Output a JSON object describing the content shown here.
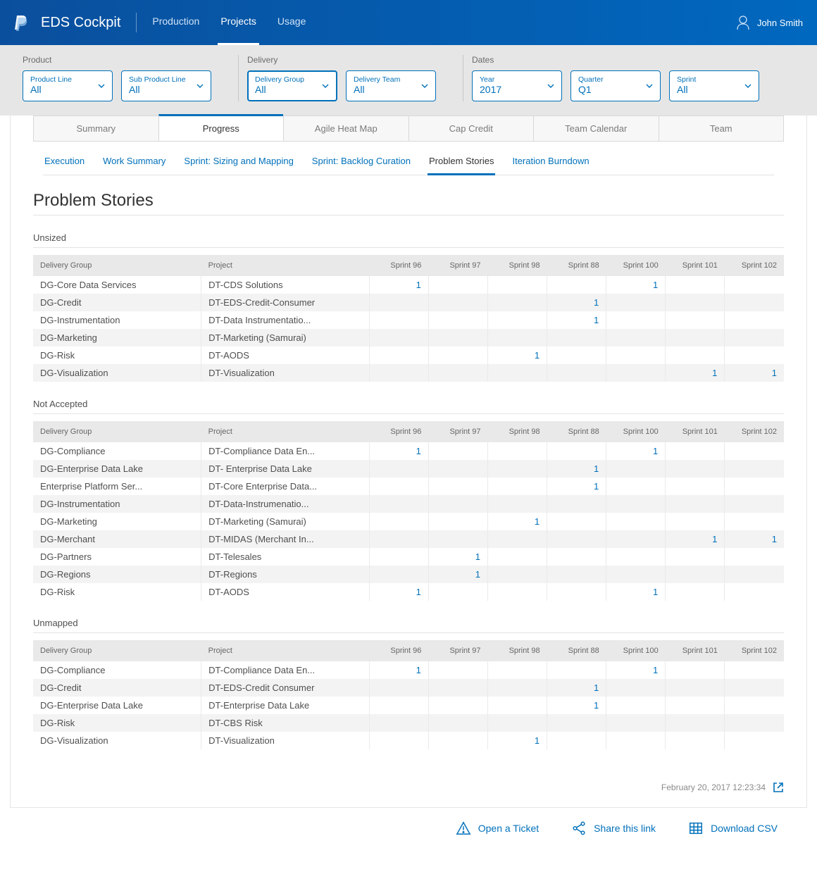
{
  "header": {
    "app_title": "EDS Cockpit",
    "nav": [
      "Production",
      "Projects",
      "Usage"
    ],
    "active_nav": 1,
    "user_name": "John Smith"
  },
  "filters": {
    "product": {
      "label": "Product",
      "items": [
        {
          "label": "Product Line",
          "value": "All"
        },
        {
          "label": "Sub Product Line",
          "value": "All"
        }
      ]
    },
    "delivery": {
      "label": "Delivery",
      "items": [
        {
          "label": "Delivery Group",
          "value": "All",
          "active": true
        },
        {
          "label": "Delivery Team",
          "value": "All"
        }
      ]
    },
    "dates": {
      "label": "Dates",
      "items": [
        {
          "label": "Year",
          "value": "2017"
        },
        {
          "label": "Quarter",
          "value": "Q1"
        },
        {
          "label": "Sprint",
          "value": "All"
        }
      ]
    }
  },
  "tabs_main": [
    "Summary",
    "Progress",
    "Agile Heat Map",
    "Cap Credit",
    "Team Calendar",
    "Team"
  ],
  "tabs_main_active": 1,
  "subtabs": [
    "Execution",
    "Work Summary",
    "Sprint: Sizing and Mapping",
    "Sprint: Backlog Curation",
    "Problem Stories",
    "Iteration Burndown"
  ],
  "subtabs_active": 4,
  "page_title": "Problem Stories",
  "columns": [
    "Delivery Group",
    "Project",
    "Sprint 96",
    "Sprint 97",
    "Sprint 98",
    "Sprint 88",
    "Sprint 100",
    "Sprint 101",
    "Sprint 102"
  ],
  "sections": [
    {
      "title": "Unsized",
      "rows": [
        {
          "dg": "DG-Core Data Services",
          "proj": "DT-CDS Solutions",
          "vals": [
            "1",
            "",
            "",
            "",
            "1",
            "",
            ""
          ]
        },
        {
          "dg": "DG-Credit",
          "proj": "DT-EDS-Credit-Consumer",
          "vals": [
            "",
            "",
            "",
            "1",
            "",
            "",
            ""
          ]
        },
        {
          "dg": "DG-Instrumentation",
          "proj": "DT-Data Instrumentatio...",
          "vals": [
            "",
            "",
            "",
            "1",
            "",
            "",
            ""
          ]
        },
        {
          "dg": "DG-Marketing",
          "proj": "DT-Marketing (Samurai)",
          "vals": [
            "",
            "",
            "",
            "",
            "",
            "",
            ""
          ]
        },
        {
          "dg": "DG-Risk",
          "proj": "DT-AODS",
          "vals": [
            "",
            "",
            "1",
            "",
            "",
            "",
            ""
          ]
        },
        {
          "dg": "DG-Visualization",
          "proj": "DT-Visualization",
          "vals": [
            "",
            "",
            "",
            "",
            "",
            "1",
            "1"
          ]
        }
      ]
    },
    {
      "title": "Not Accepted",
      "rows": [
        {
          "dg": "DG-Compliance",
          "proj": "DT-Compliance Data En...",
          "vals": [
            "1",
            "",
            "",
            "",
            "1",
            "",
            ""
          ]
        },
        {
          "dg": "DG-Enterprise Data Lake",
          "proj": "DT- Enterprise Data Lake",
          "vals": [
            "",
            "",
            "",
            "1",
            "",
            "",
            ""
          ]
        },
        {
          "dg": "Enterprise Platform Ser...",
          "proj": "DT-Core Enterprise Data...",
          "vals": [
            "",
            "",
            "",
            "1",
            "",
            "",
            ""
          ]
        },
        {
          "dg": "DG-Instrumentation",
          "proj": "DT-Data-Instrumenatio...",
          "vals": [
            "",
            "",
            "",
            "",
            "",
            "",
            ""
          ]
        },
        {
          "dg": "DG-Marketing",
          "proj": "DT-Marketing (Samurai)",
          "vals": [
            "",
            "",
            "1",
            "",
            "",
            "",
            ""
          ]
        },
        {
          "dg": "DG-Merchant",
          "proj": "DT-MIDAS (Merchant In...",
          "vals": [
            "",
            "",
            "",
            "",
            "",
            "1",
            "1"
          ]
        },
        {
          "dg": "DG-Partners",
          "proj": "DT-Telesales",
          "vals": [
            "",
            "1",
            "",
            "",
            "",
            "",
            ""
          ]
        },
        {
          "dg": "DG-Regions",
          "proj": "DT-Regions",
          "vals": [
            "",
            "1",
            "",
            "",
            "",
            "",
            ""
          ]
        },
        {
          "dg": "DG-Risk",
          "proj": "DT-AODS",
          "vals": [
            "1",
            "",
            "",
            "",
            "1",
            "",
            ""
          ]
        }
      ]
    },
    {
      "title": "Unmapped",
      "rows": [
        {
          "dg": "DG-Compliance",
          "proj": "DT-Compliance Data En...",
          "vals": [
            "1",
            "",
            "",
            "",
            "1",
            "",
            ""
          ]
        },
        {
          "dg": "DG-Credit",
          "proj": "DT-EDS-Credit Consumer",
          "vals": [
            "",
            "",
            "",
            "1",
            "",
            "",
            ""
          ]
        },
        {
          "dg": "DG-Enterprise Data Lake",
          "proj": "DT-Enterprise Data Lake",
          "vals": [
            "",
            "",
            "",
            "1",
            "",
            "",
            ""
          ]
        },
        {
          "dg": "DG-Risk",
          "proj": "DT-CBS Risk",
          "vals": [
            "",
            "",
            "",
            "",
            "",
            "",
            ""
          ]
        },
        {
          "dg": "DG-Visualization",
          "proj": "DT-Visualization",
          "vals": [
            "",
            "",
            "1",
            "",
            "",
            "",
            ""
          ]
        }
      ]
    }
  ],
  "timestamp": "February 20, 2017 12:23:34",
  "actions": {
    "ticket": "Open a Ticket",
    "share": "Share this link",
    "csv": "Download CSV"
  }
}
